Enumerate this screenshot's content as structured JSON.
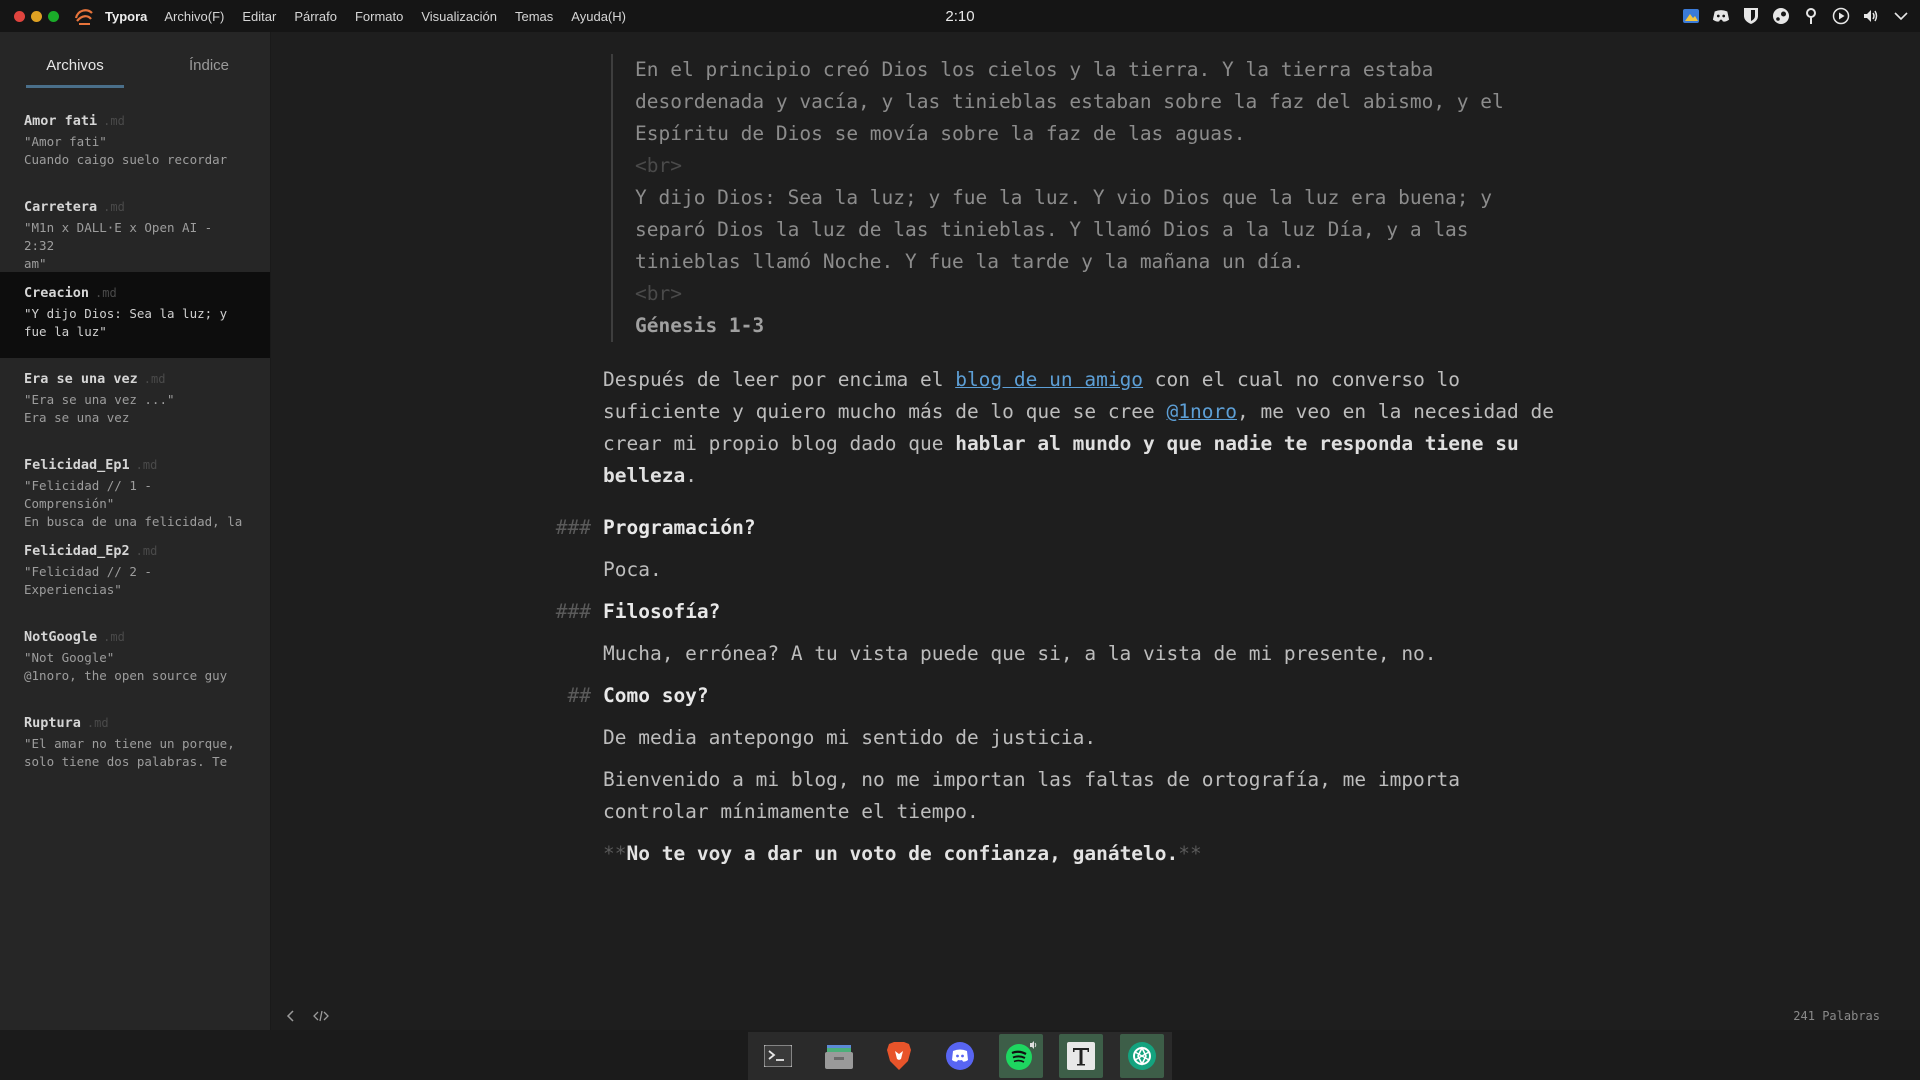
{
  "topbar": {
    "app_name": "Typora",
    "menu": [
      "Archivo(F)",
      "Editar",
      "Párrafo",
      "Formato",
      "Visualización",
      "Temas",
      "Ayuda(H)"
    ],
    "clock": "2:10",
    "tray_icons": [
      "flameshot-icon",
      "discord-icon",
      "bitwarden-icon",
      "steam-icon",
      "location-icon",
      "play-icon",
      "volume-icon",
      "chevron-down-icon"
    ],
    "colors": {
      "close": "#e0443e",
      "minimize": "#dea123",
      "maximize": "#1aab29",
      "logo": "#e8743b"
    }
  },
  "sidebar": {
    "tabs": [
      "Archivos",
      "Índice"
    ],
    "active_tab": 0,
    "files": [
      {
        "title": "Amor fati",
        "ext": ".md",
        "line1": "\"Amor fati\"",
        "line2": "Cuando caigo suelo recordar"
      },
      {
        "title": "Carretera",
        "ext": ".md",
        "line1": "\"M1n x DALL·E x Open AI - 2:32",
        "line2": "am\""
      },
      {
        "title": "Creacion",
        "ext": ".md",
        "line1": "\"Y dijo Dios: Sea la luz; y",
        "line2": "fue la luz\"",
        "active": true
      },
      {
        "title": "Era se una vez",
        "ext": ".md",
        "line1": "\"Era se una vez ...\"",
        "line2": "Era se una vez"
      },
      {
        "title": "Felicidad_Ep1",
        "ext": ".md",
        "line1": "\"Felicidad // 1 - Comprensión\"",
        "line2": "En busca de una felicidad, la"
      },
      {
        "title": "Felicidad_Ep2",
        "ext": ".md",
        "line1": "\"Felicidad // 2 -",
        "line2": "Experiencias\""
      },
      {
        "title": "NotGoogle",
        "ext": ".md",
        "line1": "\"Not Google\"",
        "line2": "@1noro, the open source guy"
      },
      {
        "title": "Ruptura",
        "ext": ".md",
        "line1": "\"El amar no tiene un porque,",
        "line2": "solo tiene dos palabras. Te"
      }
    ]
  },
  "editor": {
    "quote_p1": "En el principio creó Dios los cielos y la tierra. Y la tierra estaba desordenada y vacía, y las tinieblas estaban sobre la faz del abismo, y el Espíritu de Dios se movía sobre la faz de las aguas.",
    "br": "<br>",
    "quote_p2": "Y dijo Dios: Sea la luz; y fue la luz. Y vio Dios que la luz era buena; y separó Dios la luz de las tinieblas. Y llamó Dios a la luz Día, y a las tinieblas llamó Noche. Y fue la tarde y la mañana un día.",
    "quote_ref": "Génesis 1-3",
    "intro_a": "Después de leer por encima el ",
    "intro_link1": "blog de un amigo",
    "intro_b": " con el cual no converso lo suficiente y quiero mucho más de lo que se cree ",
    "intro_link2": "@1noro",
    "intro_c": ", me veo en la necesidad de crear mi propio blog dado que ",
    "intro_bold": "hablar al mundo y que nadie te responda tiene su belleza",
    "intro_d": ".",
    "h_programacion_marker": "###",
    "h_programacion": "Programación?",
    "p_programacion": "Poca.",
    "h_filosofia_marker": "###",
    "h_filosofia": "Filosofía?",
    "p_filosofia": "Mucha, errónea? A tu vista puede que si, a la vista de mi presente, no.",
    "h_comosoy_marker": "##",
    "h_comosoy": "Como soy?",
    "p_comosoy": "De media antepongo mi sentido de justicia.",
    "p_bienvenido": "Bienvenido a mi blog, no me importan las faltas de ortografía, me importa controlar mínimamente el tiempo.",
    "final_stars_open": "**",
    "final_text": "No te voy a dar un voto de confianza, ganátelo.",
    "final_stars_close": "**",
    "word_count": "241 Palabras"
  },
  "dock": {
    "icons": [
      "terminal-icon",
      "files-icon",
      "brave-icon",
      "discord-icon",
      "spotify-icon",
      "typora-icon",
      "chatgpt-icon"
    ]
  }
}
